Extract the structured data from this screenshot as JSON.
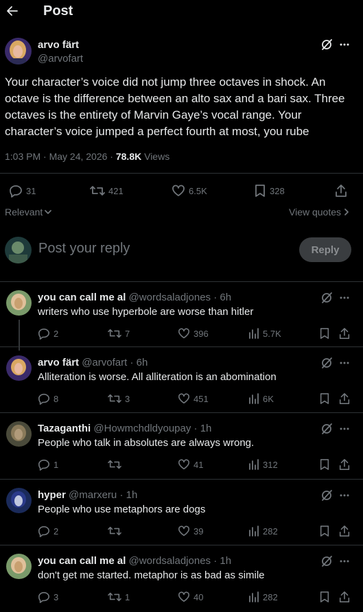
{
  "header": {
    "title": "Post"
  },
  "main_post": {
    "author_name": "arvo färt",
    "author_handle": "@arvofart",
    "text": "Your character’s voice did not jump three octaves in shock. An octave is the difference between an alto sax and a bari sax. Three octaves is the entirety of Marvin Gaye’s vocal range. Your character’s voice jumped a perfect fourth at most, you rube",
    "time": "1:03 PM · May 24, 2026 · ",
    "views_count": "78.8K",
    "views_label": " Views",
    "replies": "31",
    "reposts": "421",
    "likes": "6.5K",
    "bookmarks": "328"
  },
  "sort": {
    "label": "Relevant",
    "view_quotes": "View quotes"
  },
  "composer": {
    "placeholder": "Post your reply",
    "button": "Reply"
  },
  "replies": [
    {
      "name": "you can call me al",
      "handle": "@wordsaladjones",
      "age": "· 6h",
      "text": "writers who use hyperbole are worse than hitler",
      "replies": "2",
      "reposts": "7",
      "likes": "396",
      "views": "5.7K"
    },
    {
      "name": "arvo färt",
      "handle": "@arvofart",
      "age": "· 6h",
      "text": "Alliteration is worse. All alliteration is an abomination",
      "replies": "8",
      "reposts": "3",
      "likes": "451",
      "views": "6K"
    },
    {
      "name": "Tazaganthi",
      "handle": "@Howmchdldyoupay",
      "age": "· 1h",
      "text": "People who talk in absolutes are always wrong.",
      "replies": "1",
      "reposts": "",
      "likes": "41",
      "views": "312"
    },
    {
      "name": "hyper",
      "handle": "@marxeru",
      "age": "· 1h",
      "text": "People who use metaphors are dogs",
      "replies": "2",
      "reposts": "",
      "likes": "39",
      "views": "282"
    },
    {
      "name": "you can call me al",
      "handle": "@wordsaladjones",
      "age": "· 1h",
      "text": "don't get me started. metaphor is as bad as simile",
      "replies": "3",
      "reposts": "1",
      "likes": "40",
      "views": "282"
    }
  ],
  "icons": {
    "back": "arrow-left-icon",
    "more": "more-icon",
    "grok": "grok-icon",
    "reply": "reply-icon",
    "repost": "repost-icon",
    "like": "heart-icon",
    "views": "views-icon",
    "bookmark": "bookmark-icon",
    "share": "share-icon"
  },
  "colors": {
    "background": "#000000",
    "text": "#e7e9ea",
    "muted": "#71767b",
    "divider": "#2f3336",
    "reply_button_bg": "#3a3d40"
  }
}
